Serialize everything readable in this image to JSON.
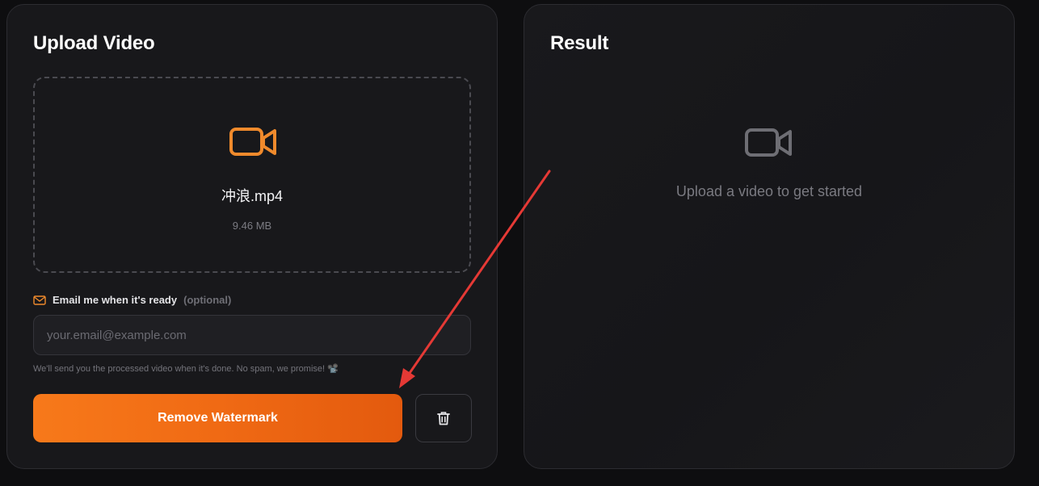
{
  "upload": {
    "title": "Upload Video",
    "file_name": "冲浪.mp4",
    "file_size": "9.46 MB",
    "icon": "video-camera-icon",
    "icon_color": "#f08a2c"
  },
  "email": {
    "label": "Email me when it's ready",
    "optional": "(optional)",
    "placeholder": "your.email@example.com",
    "value": "",
    "hint": "We'll send you the processed video when it's done. No spam, we promise! 📽️",
    "icon": "mail-icon"
  },
  "actions": {
    "remove_label": "Remove Watermark",
    "delete_icon": "trash-icon",
    "accent": "#f26e16"
  },
  "result": {
    "title": "Result",
    "empty_text": "Upload a video to get started",
    "icon": "video-camera-icon"
  },
  "annotation": {
    "arrow_color": "#e53935"
  }
}
